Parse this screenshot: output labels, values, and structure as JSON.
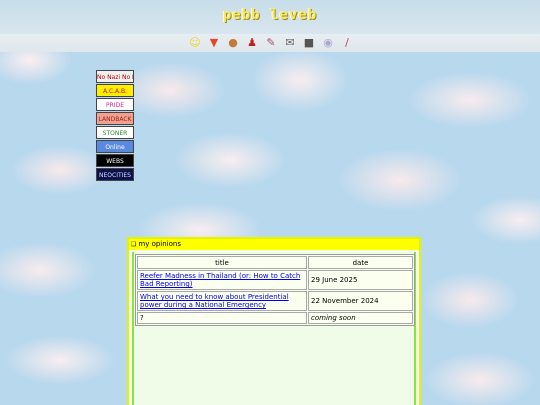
{
  "site": {
    "title": "pebb leveb"
  },
  "nav": {
    "items": [
      {
        "name": "smiley-icon",
        "glyph": "☺",
        "color": "#f2d21a"
      },
      {
        "name": "triangle-icon",
        "glyph": "▼",
        "color": "#e04a2a"
      },
      {
        "name": "palette-icon",
        "glyph": "●",
        "color": "#c47a3a"
      },
      {
        "name": "figure-icon",
        "glyph": "♟",
        "color": "#c02020"
      },
      {
        "name": "pen-icon",
        "glyph": "✎",
        "color": "#a05070"
      },
      {
        "name": "notepad-icon",
        "glyph": "✉",
        "color": "#666666"
      },
      {
        "name": "camera-icon",
        "glyph": "■",
        "color": "#555555"
      },
      {
        "name": "disc-icon",
        "glyph": "◉",
        "color": "#aaaacc"
      },
      {
        "name": "wand-icon",
        "glyph": "/",
        "color": "#d04070"
      }
    ]
  },
  "badges": [
    {
      "text": "No Nazi No Fascist",
      "bg": "#f0f0f0",
      "fg": "#c00000"
    },
    {
      "text": "A.C.A.B.",
      "bg": "#ffee00",
      "fg": "#d01010"
    },
    {
      "text": "PRIDE",
      "bg": "#ffffff",
      "fg": "#e0208a"
    },
    {
      "text": "LANDBACK",
      "bg": "#f4a090",
      "fg": "#8a2a1a"
    },
    {
      "text": "STONER",
      "bg": "#ffffff",
      "fg": "#2a8a2a"
    },
    {
      "text": "Online",
      "bg": "#5a8ae0",
      "fg": "#ffffff"
    },
    {
      "text": "WEBS",
      "bg": "#000000",
      "fg": "#ffffff"
    },
    {
      "text": "NEOCITIES",
      "bg": "#10104a",
      "fg": "#c0e0ff"
    }
  ],
  "panel": {
    "heading": "my opinions",
    "columns": [
      "title",
      "date"
    ],
    "rows": [
      {
        "title": "Reefer Madness in Thailand (or: How to Catch Bad Reporting)",
        "date": "29 June 2025",
        "link": true
      },
      {
        "title": "What you need to know about Presidential power during a National Emergency",
        "date": "22 November 2024",
        "link": true
      },
      {
        "title": "?",
        "date": "coming soon",
        "link": false
      }
    ]
  }
}
